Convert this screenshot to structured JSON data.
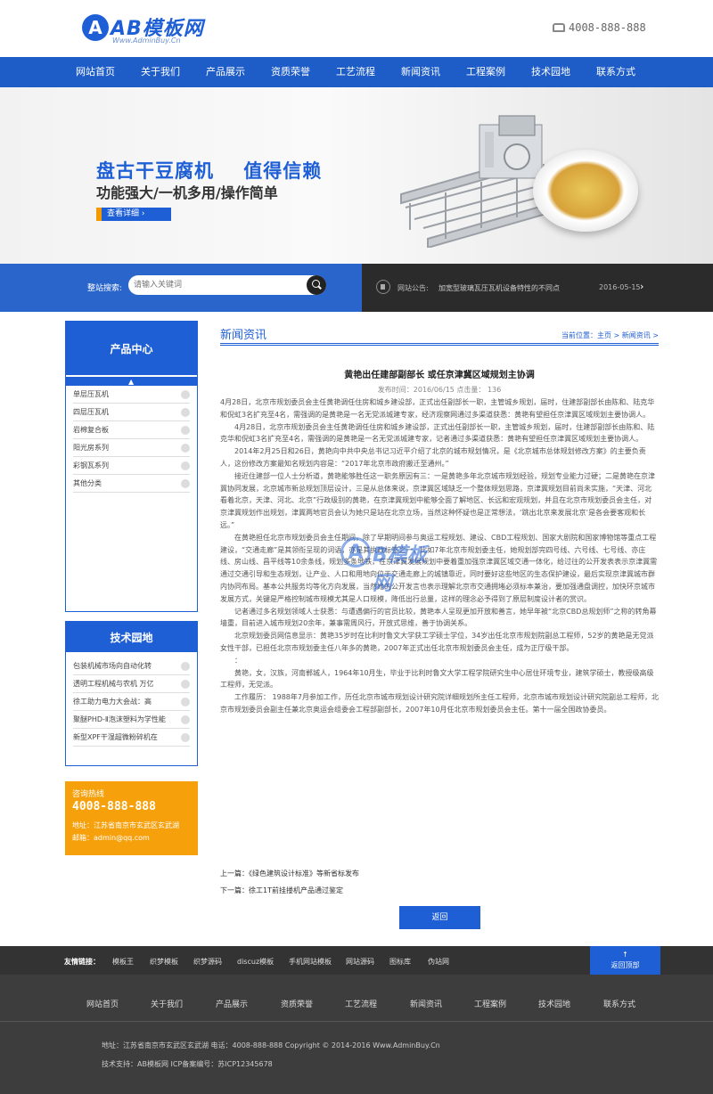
{
  "brand": {
    "logo_letter": "A",
    "name": "AB模板网",
    "sub": "Www.AdminBuy.Cn",
    "phone": "4008-888-888"
  },
  "nav": [
    "网站首页",
    "关于我们",
    "产品展示",
    "资质荣誉",
    "工艺流程",
    "新闻资讯",
    "工程案例",
    "技术园地",
    "联系方式"
  ],
  "banner": {
    "headline": "盘古干豆腐机    值得信赖",
    "subline": "功能强大/一机多用/操作简单",
    "button": "查看详细"
  },
  "search": {
    "label": "整站搜索:",
    "placeholder": "请输入关键词"
  },
  "notice": {
    "label": "网站公告:",
    "text": "加宽型玻璃瓦压瓦机设备特性的不同点",
    "date": "2016-05-15",
    "arrow": "›"
  },
  "sidebar": {
    "product_title": "产品中心",
    "products": [
      "单层压瓦机",
      "四层压瓦机",
      "岩棉复合板",
      "阳光房系列",
      "彩钢瓦系列",
      "其他分类"
    ],
    "tech_title": "技术园地",
    "tech": [
      "包装机械市场向自动化转",
      "透明工程机械与农机 万亿",
      "徐工助力电力大会战：高",
      "聚醚PHD-Ⅱ泡沫塑料为学性能",
      "新型XPF干湿超微粉碎机在"
    ],
    "contact": {
      "title": "咨询热线",
      "phone": "4008-888-888",
      "address": "地址：江苏省南京市玄武区玄武湖",
      "email": "邮箱：admin@qq.com"
    }
  },
  "main": {
    "section_title": "新闻资讯",
    "breadcrumb": "当前位置：主页 > 新闻资讯 >",
    "article_title": "黄艳出任建部副部长 或任京津冀区域规划主协调",
    "meta": "发布时间：2016/06/15    点击量：  136",
    "paragraphs": [
      {
        "t": "4月28日，北京市规划委员会主任黄艳调任住房和城乡建设部，正式出任副部长一职，主管城乡规划，届时，住建部副部长由陈和、陆克华和倪虹3名扩充至4名，需强调的是黄艳是一名无党派城建专家，经济观察网通过多渠道获悉：黄艳有望担任京津冀区域规划主要协调人。",
        "in": false
      },
      {
        "t": "4月28日，北京市规划委员会主任黄艳调任住房和城乡建设部，正式出任副部长一职，主管城乡规划，届时，住建部副部长由陈和、陆克华和倪虹3名扩充至4名，需强调的是黄艳是一名无党派城建专家，记者通过多渠道获悉：黄艳有望担任京津冀区域规划主要协调人。",
        "in": true
      },
      {
        "t": "2014年2月25日和26日，黄艳向中共中央总书记习近平介绍了北京的城市规划情况，是《北京城市总体规划修改方案》的主要负责人，这份修改方案最知名规划内容是：“2017年北京市政府搬迁至通州。”",
        "in": true
      },
      {
        "t": "接近住建部一位人士分析道，黄艳能够胜任这一职务原因有三：一是黄艳多年北京城市规划经验，规划专业能力过硬；二是黄艳在京津冀协同发展，北京城市新总规划顶层设计，三是从总体来说，京津冀区域缺乏一个整体规划思路，京津冀规划目前尚未实施，“天津、河北看着北京，天津、河北、北京”行政级别的黄艳，在京津冀规划中能够全面了解地区、长远和宏观规划，并且在北京市规划委员会主任，对京津冀规划作出规划，津冀两地官员会认为她只是站在北京立场，当然这种怀疑也是正常想法，‘跳出北京来发展北京’是各会要客观和长远。”",
        "in": true
      },
      {
        "t": "在黄艳担任北京市规划委员会主任期间，除了早期明间参与奥运工程规划、建设、CBD工程规划、国家大剧院和国家博物馆等重点工程建设，“交通走廊”是其领衔呈现的词语，亦是其执政标签之一，比如7年北京市规划委主任，她规划部完四号线、六号线、七号线、亦庄线、房山线、昌平线等10余条线，规划多条地铁，在京津冀发展规划中要着重加强京津冀区域交通一体化，给过往的公开发表表示京津冀需通过交通引导和生态规划，让产业、人口和用地向位于交通走廊上的城镇靠近，同时要好这些地区的生态保护建设，最后实现京津冀城市群内协同布局。基本公共服务均等化方向发展，当然她的公开发言也表示理解北京市交通拥堵必须标本兼治，要加强通盘调控，加快环京城市发展方式，关键是严格控制城市规模尤其是人口规模，降低出行总量，这样的理念必予得到了原层制度设计者的赏识。",
        "in": true
      },
      {
        "t": "记者通过多名规划领域人士获悉：与遭遇偏行的官员比较，黄艳本人呈现更加开放和善言，她早年被“北京CBD总规划师”之称的转角幕墙重，目前进入城市规划20余年，兼事需周风行，开放式思维，善于协调关系。",
        "in": true
      },
      {
        "t": "北京规划委员网信息显示：黄艳35岁时在比利时鲁文大学获工学硕士学位，34岁出任北京市规划院副总工程师，52岁的黄艳是无党派女性干部，已担任北京市规划委主任八年多的黄艳，2007年正式出任北京市规划委员会主任，成为正厅级干部。",
        "in": true
      },
      {
        "t": "：",
        "in": true
      },
      {
        "t": "黄艳，女，汉族，河南郸城人，1964年10月生，毕业于比利时鲁文大学工程学院研究生中心居住环境专业，建筑学硕士，教授级高级工程师，无党派。",
        "in": true
      },
      {
        "t": "工作履历：  1988年7月参加工作，历任北京市城市规划设计研究院详细规划所主任工程师，北京市城市规划设计研究院副总工程师，北京市规划委员会副主任兼北京奥运会组委会工程部副部长，2007年10月任北京市规划委员会主任。第十一届全国政协委员。",
        "in": true
      }
    ],
    "prev": "上一篇：《绿色建筑设计标准》等新省标发布",
    "next": "下一篇：徐工1T前挂搂机产品通过鉴定",
    "back": "返回"
  },
  "watermark": {
    "letter": "A",
    "text": "B模板网"
  },
  "links": {
    "label": "友情链接：",
    "items": [
      "模板王",
      "织梦模板",
      "织梦源码",
      "discuz模板",
      "手机网站模板",
      "网站源码",
      "图标库",
      "伪站网"
    ],
    "top": "返回顶部",
    "top_arrow": "↑"
  },
  "footer": {
    "nav": [
      "网站首页",
      "关于我们",
      "产品展示",
      "资质荣誉",
      "工艺流程",
      "新闻资讯",
      "工程案例",
      "技术园地",
      "联系方式"
    ],
    "line1": "地址：江苏省南京市玄武区玄武湖    电话：4008-888-888      Copyright © 2014-2016 Www.AdminBuy.Cn",
    "line2": "技术支持：AB模板网    ICP备案编号：苏ICP12345678"
  },
  "colors": {
    "primary": "#1f5fd6",
    "accent": "#f6a00c",
    "dark": "#333333"
  }
}
